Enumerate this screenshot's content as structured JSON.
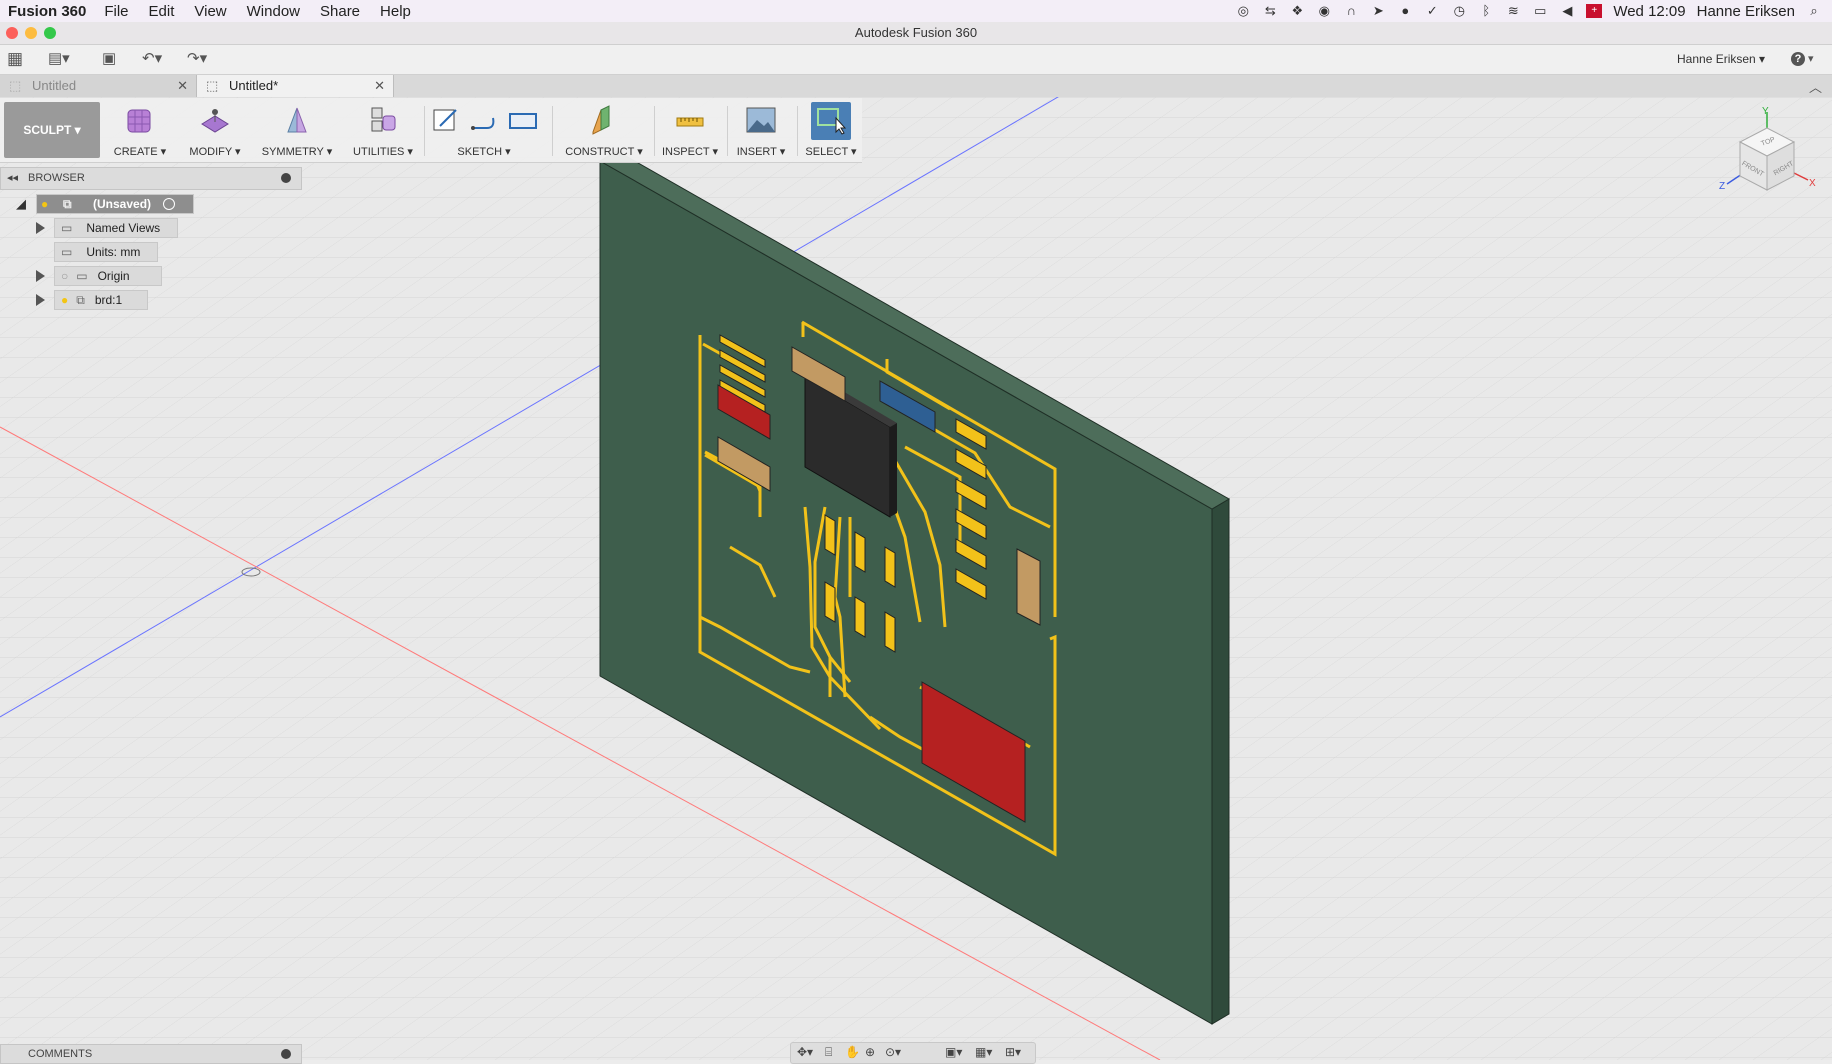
{
  "menubar": {
    "app_name": "Fusion 360",
    "items": [
      "File",
      "Edit",
      "View",
      "Window",
      "Share",
      "Help"
    ],
    "clock": "Wed 12:09",
    "user": "Hanne Eriksen"
  },
  "window": {
    "title": "Autodesk Fusion 360"
  },
  "quick_access": {
    "user_menu": "Hanne Eriksen ▾",
    "help": "?"
  },
  "tabs": [
    {
      "label": "Untitled"
    },
    {
      "label": "Untitled*"
    }
  ],
  "ribbon": {
    "workspace": "SCULPT ▾",
    "groups": [
      "CREATE ▾",
      "MODIFY ▾",
      "SYMMETRY ▾",
      "UTILITIES ▾",
      "SKETCH ▾",
      "CONSTRUCT ▾",
      "INSPECT ▾",
      "INSERT ▾",
      "SELECT ▾"
    ]
  },
  "browser": {
    "title": "BROWSER",
    "root": "(Unsaved)",
    "items": [
      "Named Views",
      "Units: mm",
      "Origin",
      "brd:1"
    ]
  },
  "comments": {
    "title": "COMMENTS"
  },
  "viewcube": {
    "faces": [
      "TOP",
      "FRONT",
      "RIGHT"
    ],
    "axes": [
      "Y",
      "Z",
      "X"
    ]
  },
  "colors": {
    "board": "#3e5e4c",
    "trace": "#f2c21a",
    "chip": "#2b2b2b",
    "pad_red": "#b52121",
    "pad_blue": "#2e5f93",
    "pad_tan": "#c29a63"
  }
}
